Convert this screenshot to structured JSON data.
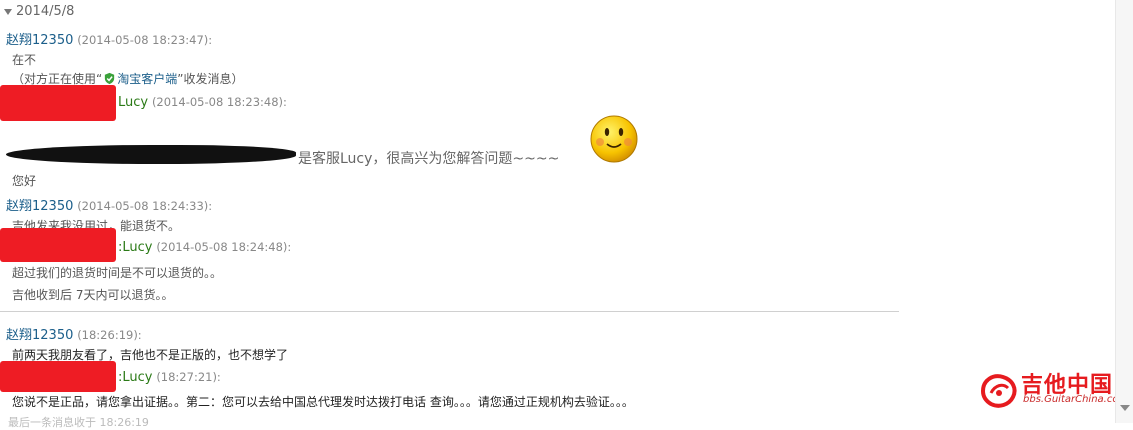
{
  "date_header": "2014/5/8",
  "messages": [
    {
      "sender": "赵翔12350",
      "time": "(2014-05-08 18:23:47):",
      "lines": [
        "在不"
      ],
      "note_pre": "（对方正在使用“",
      "note_link": "淘宝客户端",
      "note_post": "”收发消息）"
    },
    {
      "sender_suffix": "Lucy",
      "time": "(2014-05-08 18:23:48):",
      "big_line": "是客服Lucy，很高兴为您解答问题~~~~",
      "lines": [
        "您好"
      ]
    },
    {
      "sender": "赵翔12350",
      "time": "(2014-05-08 18:24:33):",
      "lines": [
        "吉他发来我没用过，能退货不。"
      ]
    },
    {
      "sender_suffix": ":Lucy",
      "time": "(2014-05-08 18:24:48):",
      "lines": [
        "超过我们的退货时间是不可以退货的。。",
        "吉他收到后 7天内可以退货。。"
      ]
    },
    {
      "sender": "赵翔12350",
      "time": "(18:26:19):",
      "lines": [
        "前两天我朋友看了，吉他也不是正版的，也不想学了"
      ]
    },
    {
      "sender_suffix": ":Lucy",
      "time": "(18:27:21):",
      "lines": [
        "您说不是正品，请您拿出证据。。第二：您可以去给中国总代理发时达拨打电话 查询。。。请您通过正规机构去验证。。。"
      ]
    }
  ],
  "footer_cut": "最后一条消息收于 18:26:19",
  "watermark": {
    "title": "吉他中国",
    "subtitle": "bbs.GuitarChina.com"
  },
  "icons": {
    "emoticon": "smiley-face-icon",
    "client": "taobao-shield-icon",
    "watermark_logo": "guitar-logo-icon",
    "collapse": "collapse-triangle-icon"
  },
  "colors": {
    "sender_customer": "#1b5e8a",
    "sender_service": "#2b7a17",
    "redaction": "#ee1c24"
  }
}
